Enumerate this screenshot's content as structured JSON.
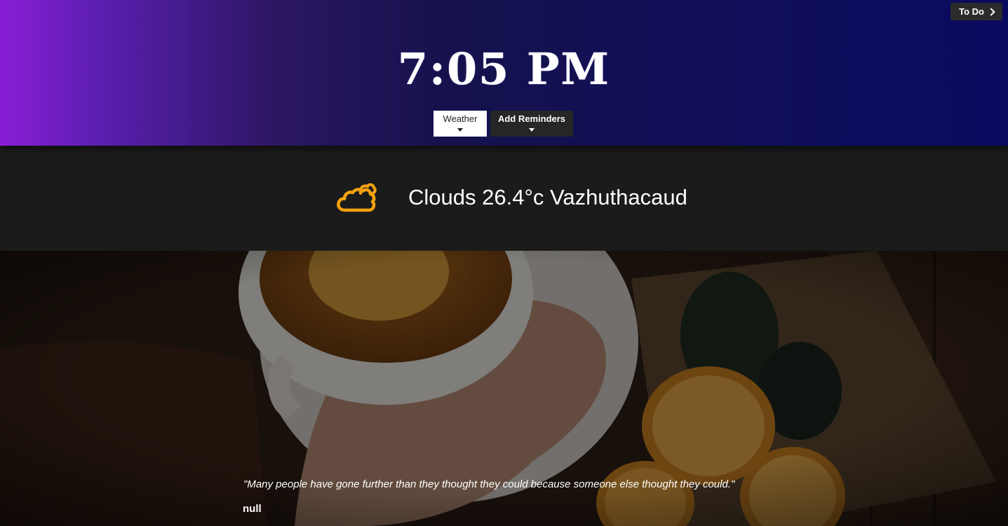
{
  "header": {
    "todo_label": "To Do",
    "time": "7:05 PM",
    "tabs": [
      {
        "label": "Weather"
      },
      {
        "label": "Add Reminders"
      }
    ]
  },
  "weather": {
    "icon": "cloud-icon",
    "summary": "Clouds 26.4°c Vazhuthacaud"
  },
  "quote": {
    "text": "\"Many people have gone further than they thought they could because someone else thought they could.\"",
    "author": "null"
  },
  "colors": {
    "accent_purple": "#8a1dd6",
    "header_navy": "#0a0a5e",
    "weather_icon": "#f5a10f"
  }
}
